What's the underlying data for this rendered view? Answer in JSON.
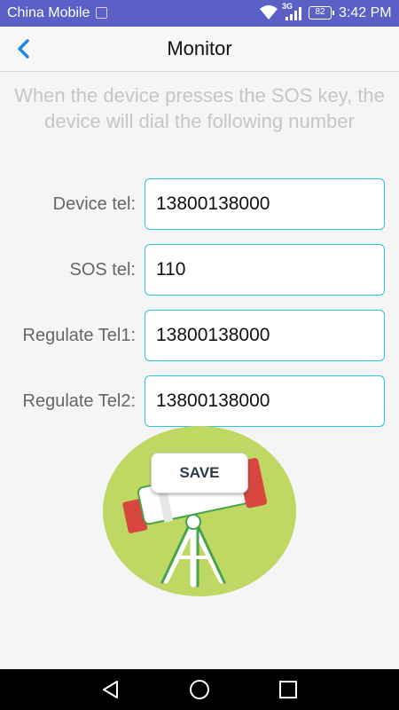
{
  "status_bar": {
    "carrier": "China Mobile",
    "network": "3G",
    "battery": "82",
    "time": "3:42 PM"
  },
  "header": {
    "title": "Monitor",
    "back_icon": "chevron-left-icon"
  },
  "description": "When the device presses the SOS key, the device will dial the following number",
  "form": {
    "device_tel": {
      "label": "Device tel:",
      "value": "13800138000"
    },
    "sos_tel": {
      "label": "SOS tel:",
      "value": "110"
    },
    "regulate_tel1": {
      "label": "Regulate Tel1:",
      "value": "13800138000"
    },
    "regulate_tel2": {
      "label": "Regulate Tel2:",
      "value": "13800138000"
    }
  },
  "save_label": "SAVE",
  "illustration": "telescope-illustration",
  "nav_bar": {
    "back": "triangle-back-icon",
    "home": "circle-home-icon",
    "recents": "square-recents-icon"
  },
  "colors": {
    "status_bar": "#5b60c7",
    "accent": "#2ec5e4",
    "back_arrow": "#1e88e5",
    "illustration_bg": "#bed863"
  }
}
